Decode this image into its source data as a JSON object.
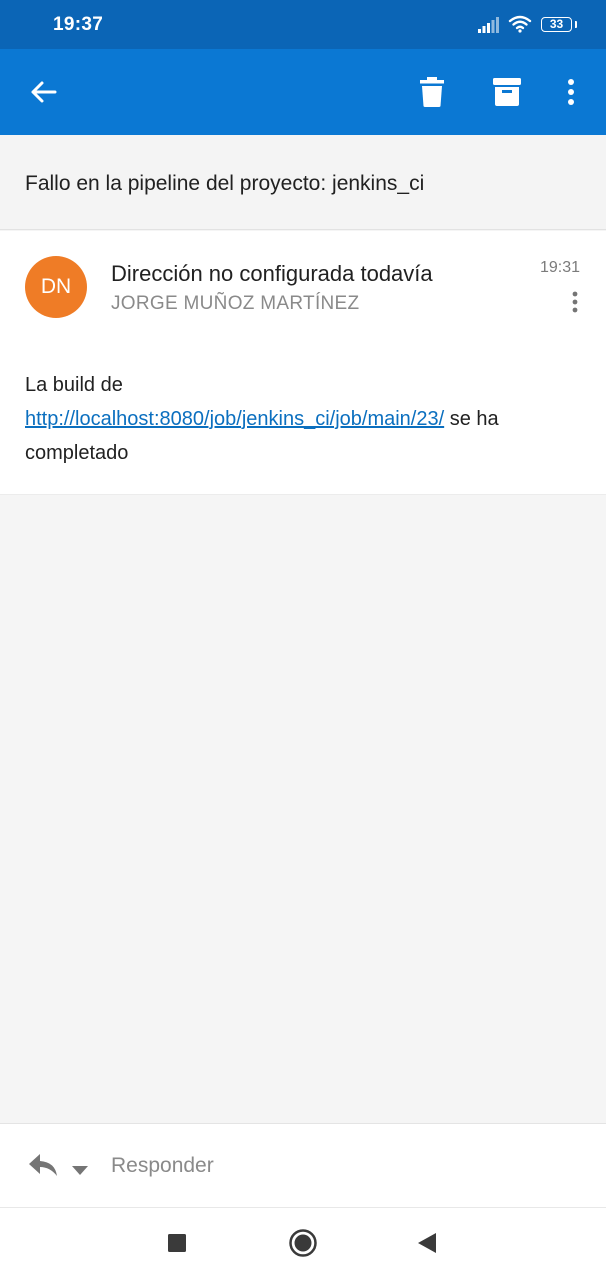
{
  "status_bar": {
    "time": "19:37",
    "battery": "33"
  },
  "toolbar": {
    "back_icon": "arrow-left-icon",
    "delete_icon": "trash-icon",
    "archive_icon": "archive-icon",
    "more_icon": "more-vertical-icon"
  },
  "email": {
    "subject": "Fallo en la pipeline del proyecto: jenkins_ci",
    "avatar_initials": "DN",
    "avatar_color": "#ef7c26",
    "sender_name": "Dirección no configurada todavía",
    "sender_address": "JORGE MUÑOZ MARTÍNEZ",
    "time": "19:31",
    "body_prefix": "La build de",
    "body_link": "http://localhost:8080/job/jenkins_ci/job/main/23/",
    "body_suffix": "se ha completado"
  },
  "reply": {
    "placeholder": "Responder"
  },
  "colors": {
    "status_bar": "#0b65b6",
    "app_bar": "#0b78d3",
    "link": "#0b6fbf"
  }
}
